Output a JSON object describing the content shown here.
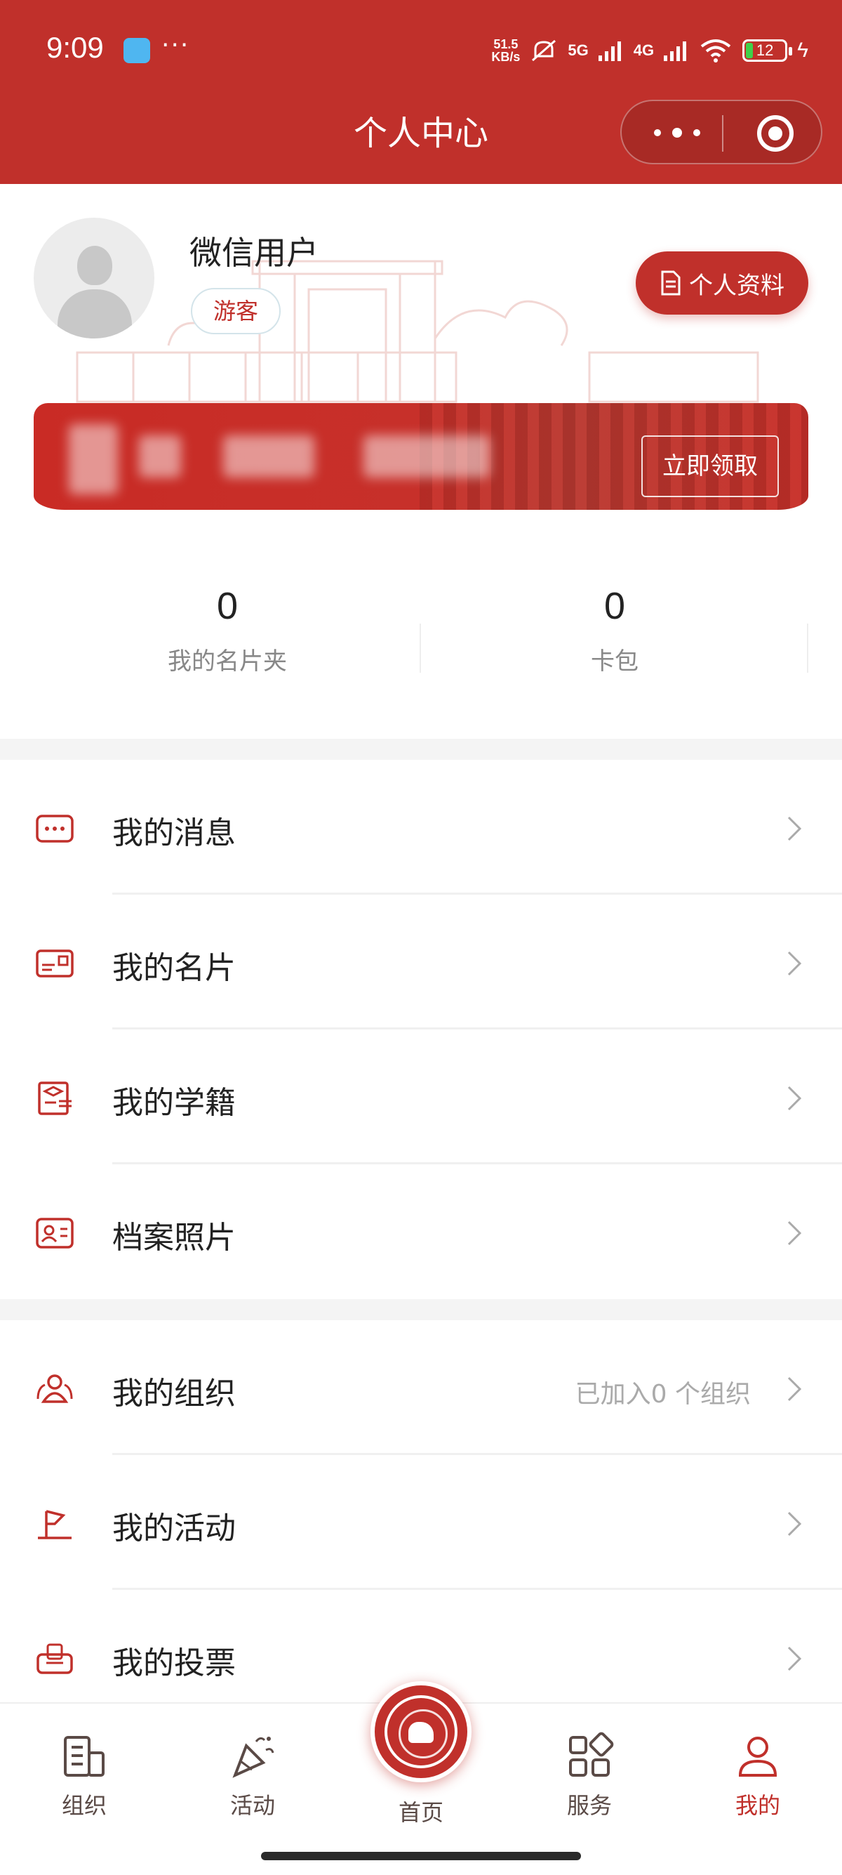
{
  "status_bar": {
    "time": "9:09",
    "more": "···",
    "net_speed_value": "51.5",
    "net_speed_unit": "KB/s",
    "signal1": "5G",
    "signal2": "4G",
    "battery": "12"
  },
  "header": {
    "title": "个人中心"
  },
  "profile": {
    "username": "微信用户",
    "role_tag": "游客",
    "profile_button": "个人资料"
  },
  "banner": {
    "claim_button": "立即领取"
  },
  "stats": [
    {
      "value": "0",
      "label": "我的名片夹"
    },
    {
      "value": "0",
      "label": "卡包"
    }
  ],
  "menu_group_1": [
    {
      "label": "我的消息",
      "icon": "message-icon"
    },
    {
      "label": "我的名片",
      "icon": "card-icon"
    },
    {
      "label": "我的学籍",
      "icon": "student-status-icon"
    },
    {
      "label": "档案照片",
      "icon": "photo-id-icon"
    }
  ],
  "menu_group_2": [
    {
      "label": "我的组织",
      "icon": "group-icon",
      "extra": "已加入0 个组织"
    },
    {
      "label": "我的活动",
      "icon": "flag-icon"
    },
    {
      "label": "我的投票",
      "icon": "vote-icon"
    }
  ],
  "tabbar": [
    {
      "label": "组织",
      "icon": "organization-icon"
    },
    {
      "label": "活动",
      "icon": "party-popper-icon"
    },
    {
      "label": "首页",
      "icon": "university-seal-icon"
    },
    {
      "label": "服务",
      "icon": "apps-icon"
    },
    {
      "label": "我的",
      "icon": "person-icon",
      "active": true
    }
  ],
  "colors": {
    "brand": "#c0302b",
    "text": "#222222",
    "muted": "#888888"
  }
}
